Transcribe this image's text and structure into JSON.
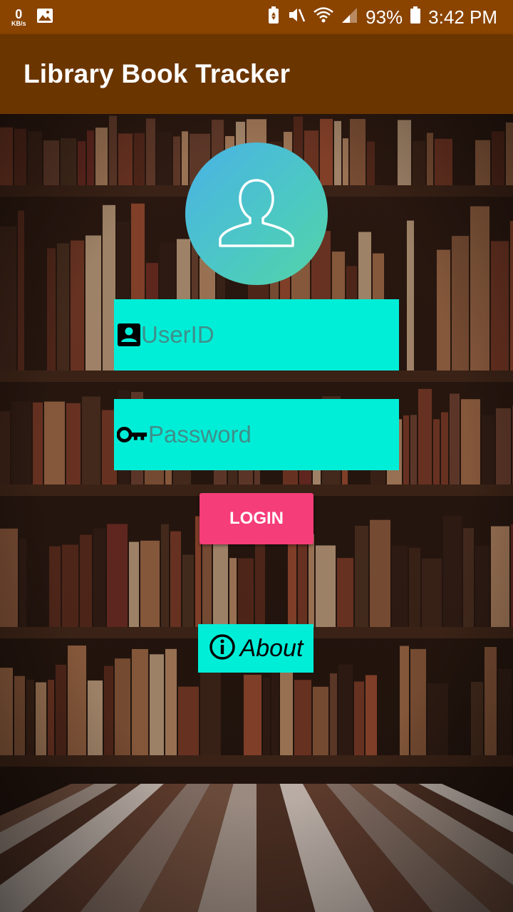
{
  "status_bar": {
    "net_speed": "0",
    "net_unit": "KB/s",
    "battery": "93%",
    "time": "3:42 PM"
  },
  "app_bar": {
    "title": "Library Book Tracker"
  },
  "login": {
    "userid_placeholder": "UserID",
    "password_placeholder": "Password",
    "login_label": "LOGIN",
    "about_label": "About"
  },
  "icons": [
    "gallery-icon",
    "battery-saver-icon",
    "mute-icon",
    "wifi-icon",
    "signal-icon",
    "battery-icon",
    "user-avatar-icon",
    "badge-icon",
    "key-icon",
    "info-icon"
  ],
  "colors": {
    "status_bar": "#8a4400",
    "app_bar": "#6b3500",
    "field_bg": "#00eed8",
    "login_bg": "#f53d7a"
  }
}
